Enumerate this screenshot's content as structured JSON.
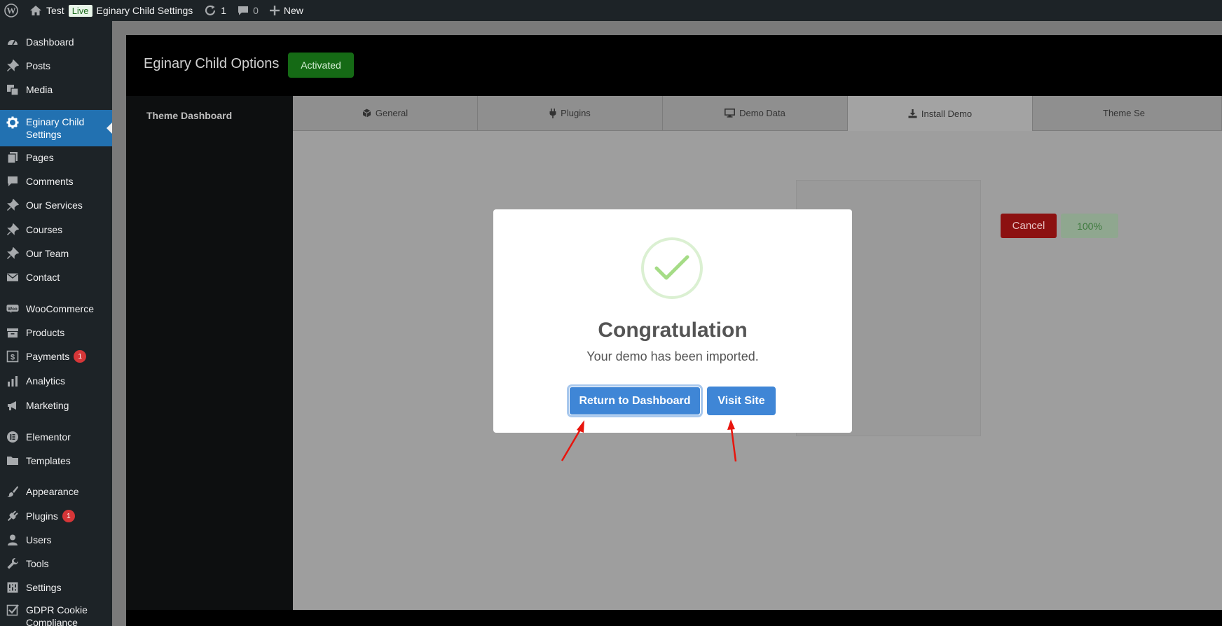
{
  "admin_bar": {
    "site_name": "Test",
    "live_badge": "Live",
    "page_name": "Eginary Child Settings",
    "updates_count": "1",
    "comments_count": "0",
    "new_label": "New"
  },
  "sidebar": {
    "items": [
      {
        "label": "Dashboard",
        "icon": "dashboard-icon"
      },
      {
        "label": "Posts",
        "icon": "pin-icon"
      },
      {
        "label": "Media",
        "icon": "media-icon"
      },
      {
        "label": "Eginary Child Settings",
        "icon": "gear-icon",
        "current": true
      },
      {
        "label": "Pages",
        "icon": "pages-icon"
      },
      {
        "label": "Comments",
        "icon": "comment-icon"
      },
      {
        "label": "Our Services",
        "icon": "pin-icon"
      },
      {
        "label": "Courses",
        "icon": "pin-icon"
      },
      {
        "label": "Our Team",
        "icon": "pin-icon"
      },
      {
        "label": "Contact",
        "icon": "mail-icon"
      },
      {
        "label": "WooCommerce",
        "icon": "woo-icon"
      },
      {
        "label": "Products",
        "icon": "archive-icon"
      },
      {
        "label": "Payments",
        "icon": "dollar-icon",
        "badge": "1"
      },
      {
        "label": "Analytics",
        "icon": "chart-icon"
      },
      {
        "label": "Marketing",
        "icon": "megaphone-icon"
      },
      {
        "label": "Elementor",
        "icon": "elementor-icon"
      },
      {
        "label": "Templates",
        "icon": "folder-icon"
      },
      {
        "label": "Appearance",
        "icon": "brush-icon"
      },
      {
        "label": "Plugins",
        "icon": "plug-icon",
        "badge": "1"
      },
      {
        "label": "Users",
        "icon": "user-icon"
      },
      {
        "label": "Tools",
        "icon": "wrench-icon"
      },
      {
        "label": "Settings",
        "icon": "settings-icon"
      },
      {
        "label": "GDPR Cookie Compliance",
        "icon": "check-icon"
      }
    ]
  },
  "panel": {
    "title": "Eginary Child Options",
    "status_badge": "Activated",
    "left_nav_item": "Theme Dashboard",
    "tabs": [
      {
        "label": "General",
        "icon": "cube-icon"
      },
      {
        "label": "Plugins",
        "icon": "plug-icon"
      },
      {
        "label": "Demo Data",
        "icon": "monitor-icon"
      },
      {
        "label": "Install Demo",
        "icon": "download-icon",
        "active": true
      },
      {
        "label": "Theme Se",
        "icon": ""
      }
    ],
    "cancel_label": "Cancel",
    "progress_label": "100%"
  },
  "modal": {
    "title": "Congratulation",
    "message": "Your demo has been imported.",
    "primary_button": "Return to Dashboard",
    "secondary_button": "Visit Site"
  },
  "colors": {
    "accent_blue": "#3f86d6",
    "wp_current": "#2271b1",
    "activated_green": "#156a15",
    "cancel_red": "#8c1111",
    "arrow_red": "#e8150d",
    "badge_red": "#d63638"
  }
}
